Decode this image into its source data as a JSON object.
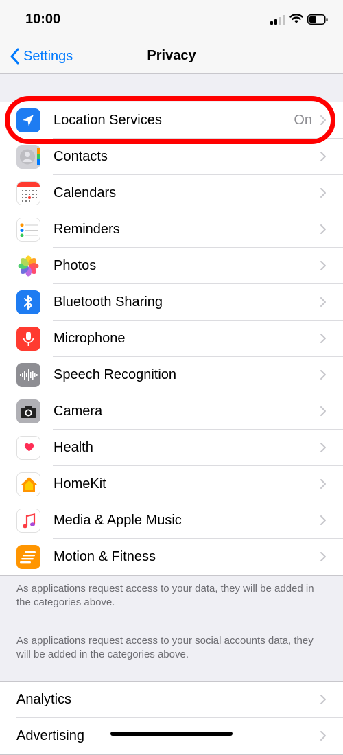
{
  "status_bar": {
    "time": "10:00"
  },
  "nav": {
    "back_label": "Settings",
    "title": "Privacy"
  },
  "privacy_items": [
    {
      "label": "Location Services",
      "value": "On",
      "icon": "location-arrow-icon",
      "color": "#1e7cf2"
    },
    {
      "label": "Contacts",
      "value": "",
      "icon": "contacts-icon",
      "color": "#c7c7cc"
    },
    {
      "label": "Calendars",
      "value": "",
      "icon": "calendar-icon",
      "color": "#ff3b30"
    },
    {
      "label": "Reminders",
      "value": "",
      "icon": "reminders-icon",
      "color": "#ffffff"
    },
    {
      "label": "Photos",
      "value": "",
      "icon": "photos-icon",
      "color": "#ffffff"
    },
    {
      "label": "Bluetooth Sharing",
      "value": "",
      "icon": "bluetooth-icon",
      "color": "#1e7cf2"
    },
    {
      "label": "Microphone",
      "value": "",
      "icon": "microphone-icon",
      "color": "#ff3b30"
    },
    {
      "label": "Speech Recognition",
      "value": "",
      "icon": "speech-recognition-icon",
      "color": "#8e8e93"
    },
    {
      "label": "Camera",
      "value": "",
      "icon": "camera-icon",
      "color": "#8e8e93"
    },
    {
      "label": "Health",
      "value": "",
      "icon": "health-heart-icon",
      "color": "#ff2d55"
    },
    {
      "label": "HomeKit",
      "value": "",
      "icon": "homekit-icon",
      "color": "#ff9500"
    },
    {
      "label": "Media & Apple Music",
      "value": "",
      "icon": "music-note-icon",
      "color": "#fc3c44"
    },
    {
      "label": "Motion & Fitness",
      "value": "",
      "icon": "motion-fitness-icon",
      "color": "#ff9500"
    }
  ],
  "footer_notes": {
    "data_access": "As applications request access to your data, they will be added in the categories above.",
    "social_access": "As applications request access to your social accounts data, they will be added in the categories above."
  },
  "other_items": [
    {
      "label": "Analytics"
    },
    {
      "label": "Advertising"
    }
  ],
  "colors": {
    "ios_blue": "#007aff",
    "highlight_red": "#ff0000",
    "background": "#efeff4"
  }
}
